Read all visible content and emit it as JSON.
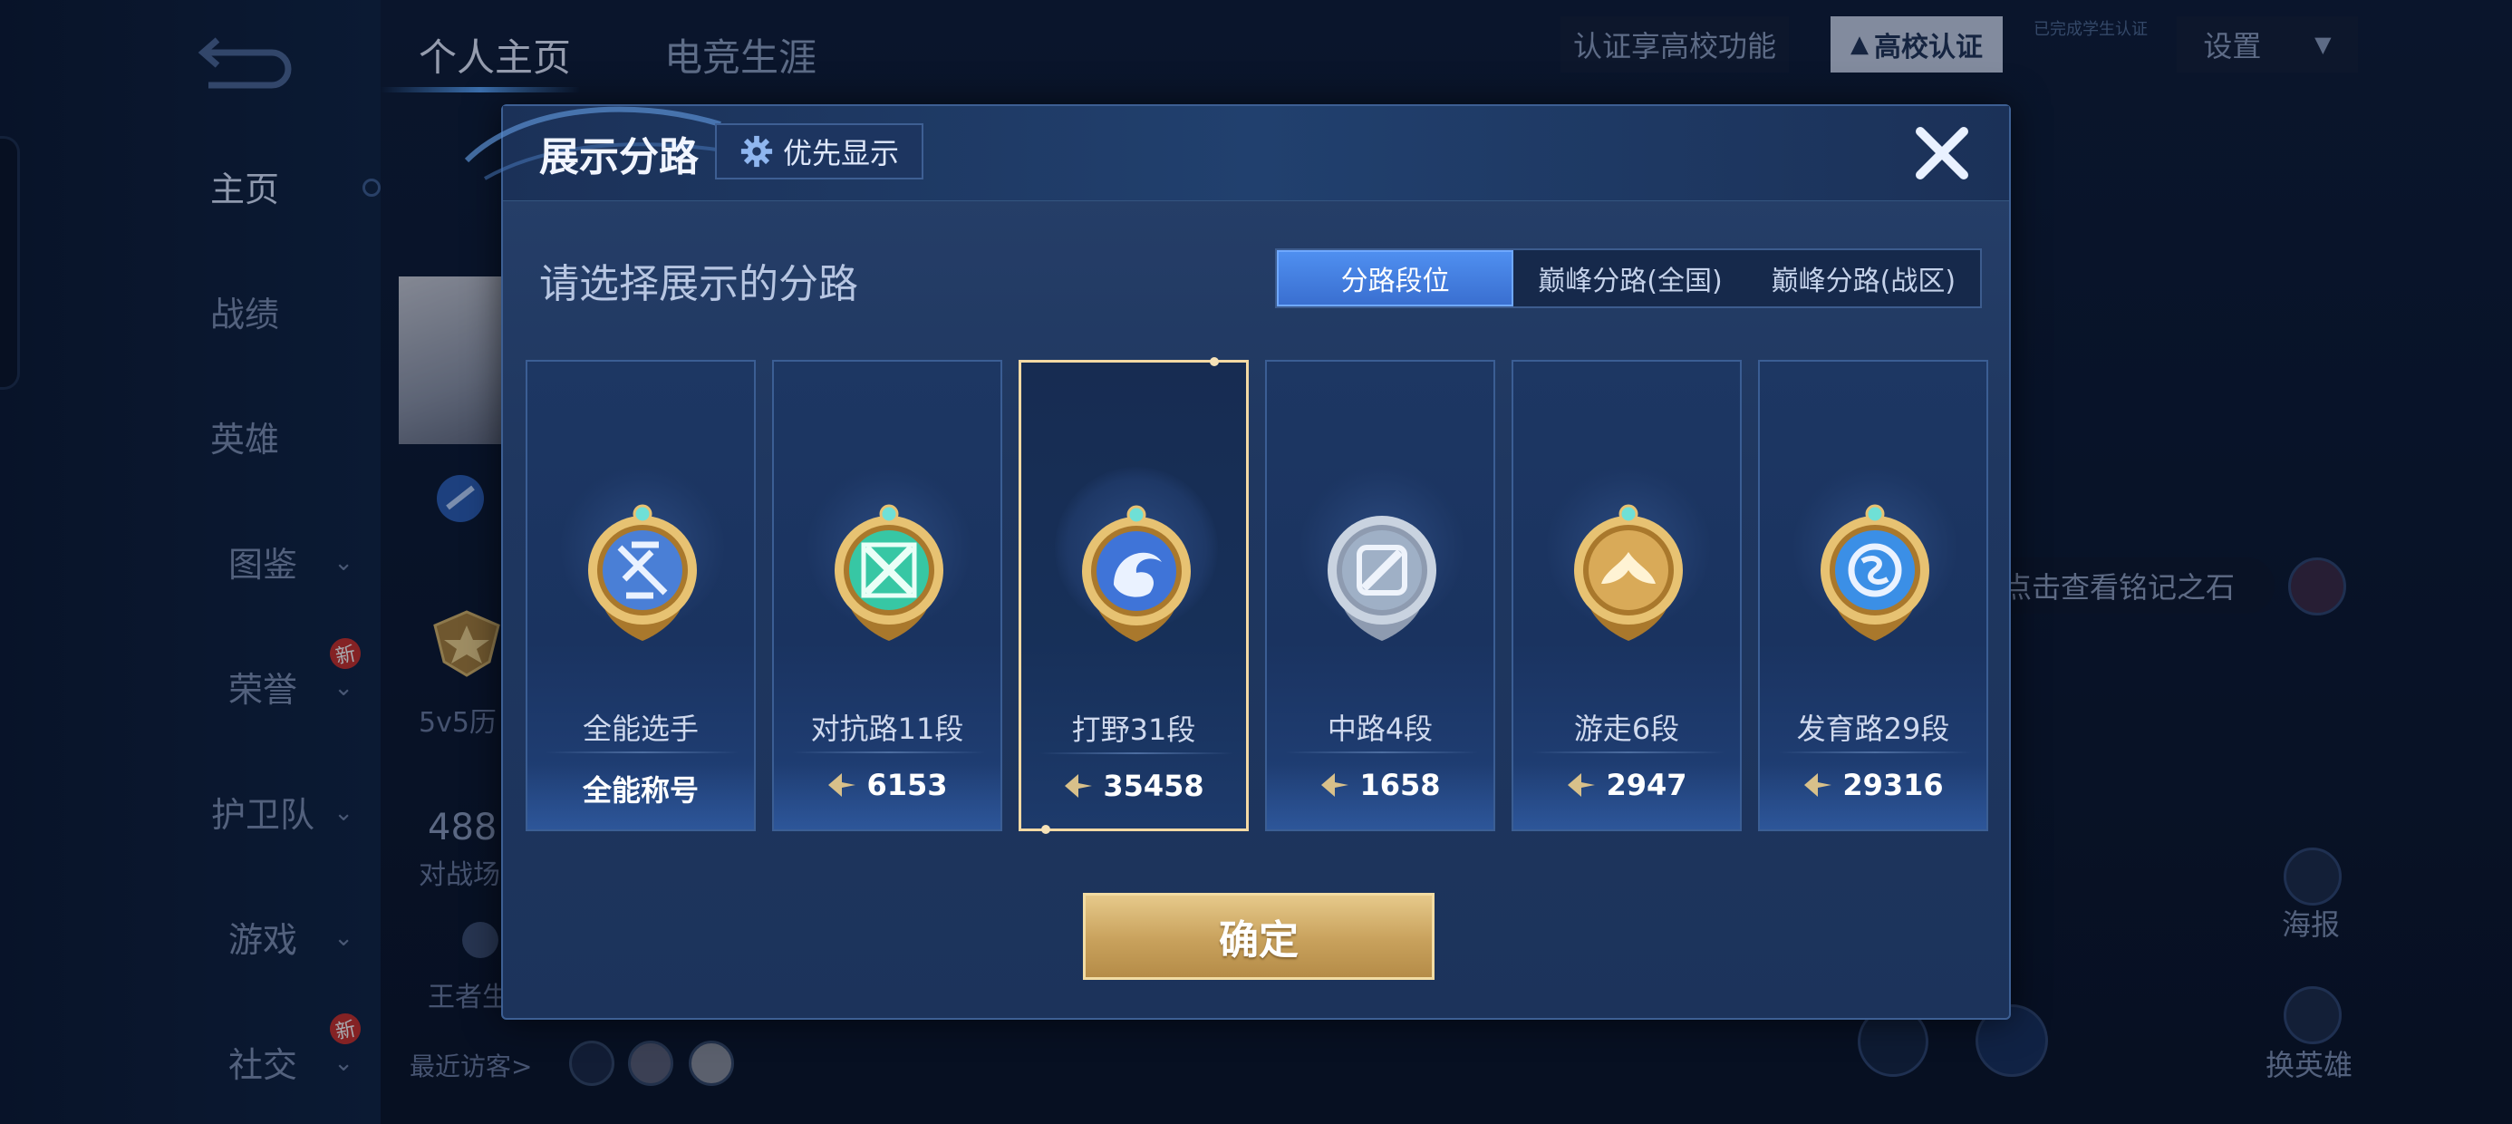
{
  "top_tabs": [
    "个人主页",
    "电竞生涯"
  ],
  "sidebar": {
    "items": [
      {
        "label": "主页",
        "active": true,
        "has_chevron": false
      },
      {
        "label": "战绩",
        "has_chevron": false
      },
      {
        "label": "英雄",
        "has_chevron": false
      },
      {
        "label": "图鉴",
        "has_chevron": true
      },
      {
        "label": "荣誉",
        "has_chevron": true,
        "badge": "新"
      },
      {
        "label": "护卫队",
        "has_chevron": true
      },
      {
        "label": "游戏",
        "has_chevron": true
      },
      {
        "label": "社交",
        "has_chevron": true,
        "badge": "新"
      }
    ],
    "chevron": "⌄"
  },
  "background": {
    "history_label": "5v5历",
    "count_value": "488",
    "count_label": "对战场",
    "king_label": "王者生",
    "visitors_label": "最近访客>",
    "school_hint": "认证享高校功能",
    "school_button": "高校认证",
    "school_small": "已完成学生认证",
    "settings": "设置",
    "rune_hint": "点击查看铭记之石",
    "poster_label": "海报",
    "switch_hero_label": "换英雄"
  },
  "modal": {
    "title": "展示分路",
    "priority_button": "优先显示",
    "subtitle": "请选择展示的分路",
    "segments": [
      {
        "label": "分路段位",
        "active": true
      },
      {
        "label": "巅峰分路(全国)",
        "active": false
      },
      {
        "label": "巅峰分路(战区)",
        "active": false
      }
    ],
    "cards": [
      {
        "label": "全能选手",
        "value": "全能称号",
        "show_icon": false,
        "selected": false,
        "emblem_color": "#4a7fd6"
      },
      {
        "label": "对抗路11段",
        "value": "6153",
        "show_icon": true,
        "selected": false,
        "emblem_color": "#37c7a4"
      },
      {
        "label": "打野31段",
        "value": "35458",
        "show_icon": true,
        "selected": true,
        "emblem_color": "#3f74d8"
      },
      {
        "label": "中路4段",
        "value": "1658",
        "show_icon": true,
        "selected": false,
        "emblem_color": "#9fb0c6"
      },
      {
        "label": "游走6段",
        "value": "2947",
        "show_icon": true,
        "selected": false,
        "emblem_color": "#d9aa58"
      },
      {
        "label": "发育路29段",
        "value": "29316",
        "show_icon": true,
        "selected": false,
        "emblem_color": "#3b8fe6"
      }
    ],
    "confirm_button": "确定"
  },
  "colors": {
    "accent": "#3a6fd0",
    "selected_border": "#f3d9a4",
    "confirm_gold": "#c8a15c",
    "points_icon": "#d8c08a"
  }
}
